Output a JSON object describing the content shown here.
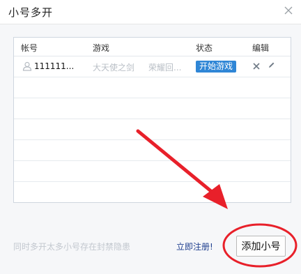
{
  "dialog": {
    "title": "小号多开"
  },
  "table": {
    "columns": [
      {
        "key": "account",
        "label": "帐号"
      },
      {
        "key": "game",
        "label": "游戏"
      },
      {
        "key": "status",
        "label": "状态"
      },
      {
        "key": "edit",
        "label": "编辑"
      }
    ],
    "rows": [
      {
        "account": "111111...",
        "game": "大天使之剑",
        "server": "荣耀回...",
        "status_button": "开始游戏"
      }
    ]
  },
  "footer": {
    "hint": "同时多开太多小号存在封禁隐患",
    "register_link": "立即注册!",
    "add_button": "添加小号"
  },
  "colors": {
    "accent": "#2f86d6",
    "annotation": "#e8202a"
  }
}
